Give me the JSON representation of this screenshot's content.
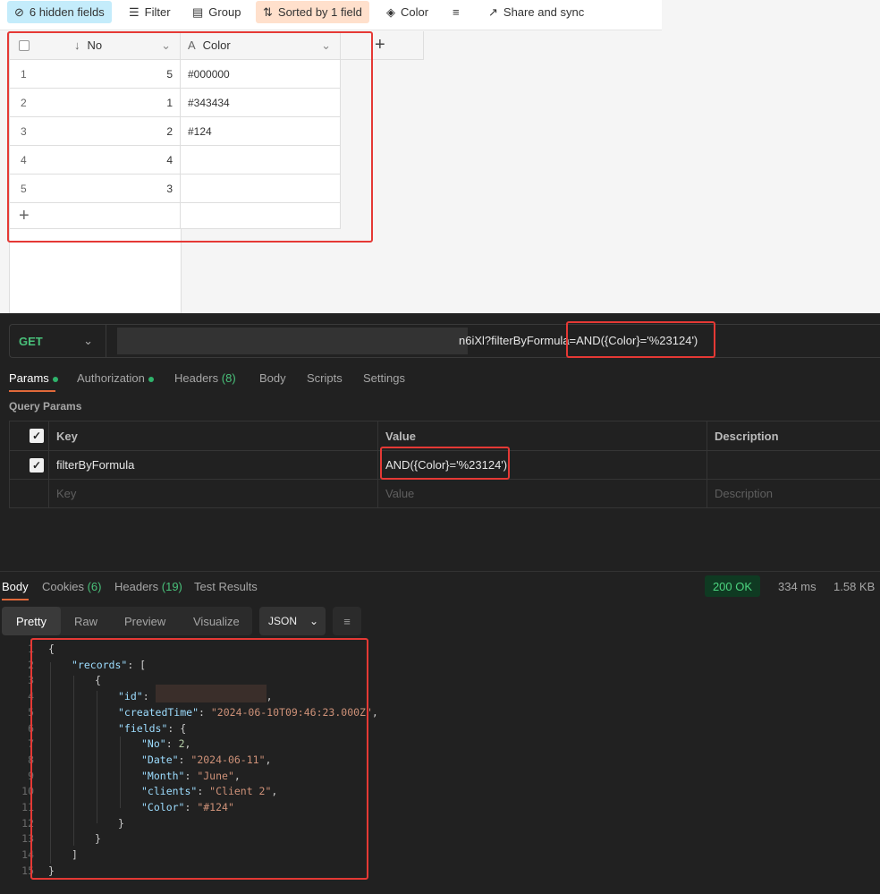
{
  "toolbar": {
    "hidden": "6 hidden fields",
    "filter": "Filter",
    "group": "Group",
    "sorted": "Sorted by 1 field",
    "color": "Color",
    "share": "Share and sync"
  },
  "grid": {
    "columns": [
      "No",
      "Color"
    ],
    "rows": [
      {
        "n": "1",
        "no": "5",
        "color": "#000000"
      },
      {
        "n": "2",
        "no": "1",
        "color": "#343434"
      },
      {
        "n": "3",
        "no": "2",
        "color": "#124"
      },
      {
        "n": "4",
        "no": "4",
        "color": ""
      },
      {
        "n": "5",
        "no": "3",
        "color": ""
      }
    ],
    "add": "+"
  },
  "request": {
    "method": "GET",
    "url_visible": "n6iXl?filterByFormula=",
    "url_formula": "AND({Color}='%23124')"
  },
  "req_tabs": {
    "params": "Params",
    "auth": "Authorization",
    "headers": "Headers",
    "headers_count": "(8)",
    "body": "Body",
    "scripts": "Scripts",
    "settings": "Settings"
  },
  "query": {
    "title": "Query Params",
    "key_h": "Key",
    "value_h": "Value",
    "desc_h": "Description",
    "row_key": "filterByFormula",
    "row_value": "AND({Color}='%23124')",
    "key_ph": "Key",
    "value_ph": "Value",
    "desc_ph": "Description"
  },
  "resp_tabs": {
    "body": "Body",
    "cookies": "Cookies",
    "cookies_count": "(6)",
    "headers": "Headers",
    "headers_count": "(19)",
    "tests": "Test Results"
  },
  "status": {
    "code": "200 OK",
    "time": "334 ms",
    "size": "1.58 KB"
  },
  "view": {
    "pretty": "Pretty",
    "raw": "Raw",
    "preview": "Preview",
    "visualize": "Visualize",
    "format": "JSON"
  },
  "code": {
    "lines": [
      "1",
      "2",
      "3",
      "4",
      "5",
      "6",
      "7",
      "8",
      "9",
      "10",
      "11",
      "12",
      "13",
      "14",
      "15"
    ],
    "records": "\"records\"",
    "id": "\"id\"",
    "createdTime": "\"createdTime\"",
    "createdVal": "\"2024-06-10T09:46:23.000Z\"",
    "fields": "\"fields\"",
    "no": "\"No\"",
    "noVal": "2",
    "date": "\"Date\"",
    "dateVal": "\"2024-06-11\"",
    "month": "\"Month\"",
    "monthVal": "\"June\"",
    "clients": "\"clients\"",
    "clientsVal": "\"Client 2\"",
    "color": "\"Color\"",
    "colorVal": "\"#124\""
  }
}
